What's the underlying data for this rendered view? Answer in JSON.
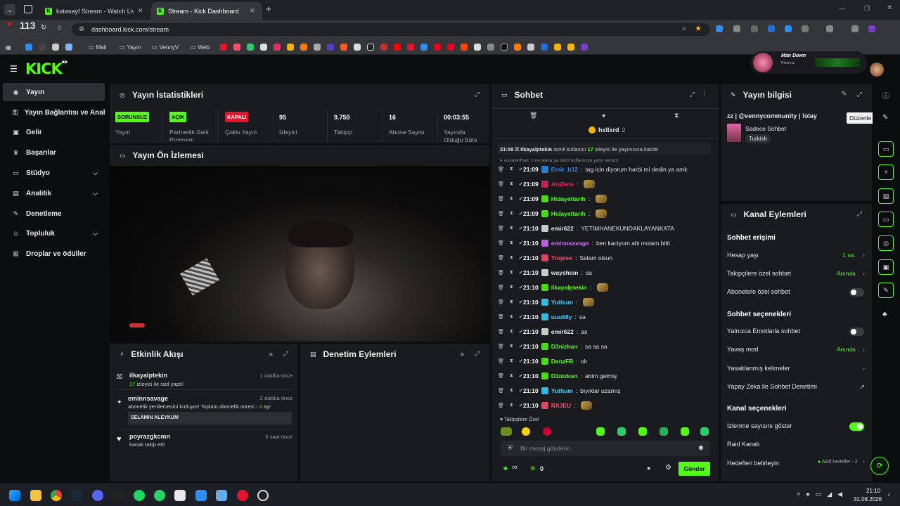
{
  "browser": {
    "tabs": [
      {
        "label": "katasayf Stream - Watch Live o"
      },
      {
        "label": "Stream - Kick Dashboard"
      }
    ],
    "notification_count": "113",
    "url": "dashboard.kick.com/stream",
    "bookmarks": [
      "Mail",
      "Yayın",
      "VennyV",
      "Web"
    ]
  },
  "header": {
    "logo": "KICK",
    "logo_sup": "BETA",
    "now_playing_title": "Man Down",
    "now_playing_artist": "Rihanna"
  },
  "sidebar": {
    "items": [
      {
        "label": "Yayın",
        "icon": "broadcast-icon"
      },
      {
        "label": "Yayın Bağlantısı ve Anahtarı",
        "icon": "key-icon"
      },
      {
        "label": "Gelir",
        "icon": "revenue-icon"
      },
      {
        "label": "Başarılar",
        "icon": "trophy-icon"
      },
      {
        "label": "Stüdyo",
        "icon": "studio-icon"
      },
      {
        "label": "Analitik",
        "icon": "analytics-icon"
      },
      {
        "label": "Denetleme",
        "icon": "wrench-icon"
      },
      {
        "label": "Topluluk",
        "icon": "community-icon"
      },
      {
        "label": "Droplar ve ödüller",
        "icon": "gift-icon"
      }
    ]
  },
  "stats": {
    "title": "Yayın İstatistikleri",
    "items": [
      {
        "value": "SORUNSUZ",
        "label": "Yayın",
        "badge_color": "#53fc18"
      },
      {
        "value": "AÇIK",
        "label": "Partnerlik Gelir Programı",
        "badge_color": "#53fc18"
      },
      {
        "value": "KAPALI",
        "label": "Çoklu Yayın",
        "badge_color": "#e5132b"
      },
      {
        "value": "95",
        "label": "İzleyici"
      },
      {
        "value": "9.750",
        "label": "Takipçi"
      },
      {
        "value": "16",
        "label": "Abone Sayısı"
      },
      {
        "value": "00:03:55",
        "label": "Yayında Olduğu Süre"
      }
    ]
  },
  "preview": {
    "title": "Yayın Ön İzlemesi"
  },
  "activity": {
    "title": "Etkinlik Akışı",
    "items": [
      {
        "user": "ilkayalptekin",
        "time": "1 dakika önce",
        "count": "17",
        "text": "izleyici ile raid yaptı!"
      },
      {
        "user": "eminnsavage",
        "time": "2 dakika önce",
        "text": "abonelik yenilemesini kutluyor! Toplam abonelik süresi -",
        "count": "2",
        "unit": "ay!",
        "quote": "SELAMIN ALEYKUM"
      },
      {
        "user": "poyrazgkcmn",
        "time": "5 saat önce",
        "text": "kanalı takip etti"
      }
    ]
  },
  "moderation": {
    "title": "Denetim Eylemleri"
  },
  "chat": {
    "title": "Sohbet",
    "pinned_user": "hxllxrd",
    "pinned_count": "2",
    "raid_notice": {
      "time": "21:09",
      "user": "ilkayalptekin",
      "text_a": "isimli kullanıcı",
      "count": "17",
      "text_b": "izleyici ile yayınınıza katıldı"
    },
    "reply_notice": "AssasinHan: o ne alaka ya isimli kullanıcıya yanıt veriyor",
    "messages": [
      {
        "time": "21:09",
        "user": "Emir_b12",
        "color": "#2f8cf0",
        "text": "tag icin diyorum harbi mi dedin ya amk"
      },
      {
        "time": "21:09",
        "user": "AtaDete",
        "color": "#e0245e",
        "text": ""
      },
      {
        "time": "21:09",
        "user": "Hidayettarih",
        "color": "#53fc18",
        "text": ""
      },
      {
        "time": "21:09",
        "user": "Hidayettarih",
        "color": "#53fc18",
        "text": ""
      },
      {
        "time": "21:10",
        "user": "emir622",
        "color": "#e8e8e8",
        "text": "YETİMHANEKUNDAKLAYANKATA"
      },
      {
        "time": "21:10",
        "user": "eminnsavage",
        "color": "#d36bff",
        "text": "ben kaciyom abi molam bitti"
      },
      {
        "time": "21:10",
        "user": "Troplex",
        "color": "#ff4d6d",
        "text": "Selam olsun"
      },
      {
        "time": "21:10",
        "user": "wayshion",
        "color": "#e8e8e8",
        "text": "sa"
      },
      {
        "time": "21:10",
        "user": "ilkayalptekin",
        "color": "#53fc18",
        "text": ""
      },
      {
        "time": "21:10",
        "user": "Yuthum",
        "color": "#3fd2ff",
        "text": ""
      },
      {
        "time": "21:10",
        "user": "uuu68y",
        "color": "#3fd2ff",
        "text": "sa"
      },
      {
        "time": "21:10",
        "user": "emir622",
        "color": "#e8e8e8",
        "text": "as"
      },
      {
        "time": "21:10",
        "user": "D3nizkun",
        "color": "#53fc18",
        "text": "sa sa sa"
      },
      {
        "time": "21:10",
        "user": "DenzFR",
        "color": "#53fc18",
        "text": "olr"
      },
      {
        "time": "21:10",
        "user": "D3nizkun",
        "color": "#53fc18",
        "text": "abim gelmiş"
      },
      {
        "time": "21:10",
        "user": "Yuthum",
        "color": "#3fd2ff",
        "text": "bıyıklar uzamış"
      },
      {
        "time": "21:10",
        "user": "RXJEU",
        "color": "#ff4d6d",
        "text": ""
      }
    ],
    "followers_only": "Takipçilere Özel",
    "input_placeholder": "Bir mesaj gönderin",
    "points_value": "0",
    "infinity": "∞",
    "send_label": "Gönder"
  },
  "stream_info": {
    "title": "Yayın bilgisi",
    "stream_title": "zz | @vennycommunity | !olay",
    "category": "Sadece Sohbet",
    "language": "Turkish",
    "tooltip": "Düzenle"
  },
  "channel_actions": {
    "title": "Kanal Eylemleri",
    "section_access": "Sohbet erişimi",
    "account_age_label": "Hesap yaşı",
    "account_age_value": "1 sa.",
    "followers_chat_label": "Takipçilere özel sohbet",
    "followers_chat_value": "Anında",
    "subscribers_chat_label": "Abonelere özel sohbet",
    "section_options": "Sohbet seçenekleri",
    "emote_only_label": "Yalnızca Emotlarla sohbet",
    "slow_mode_label": "Yavaş mod",
    "slow_mode_value": "Anında",
    "banned_words_label": "Yasaklanmış kelimeler",
    "ai_moderation_label": "Yapay Zeka ile Sohbet Denetimi",
    "section_channel": "Kanal seçenekleri",
    "show_viewers_label": "İzlenme sayısını göster",
    "raid_label": "Raid Kanalı",
    "goals_label": "Hedefleri belirleyin",
    "goals_value": "Aktif hedefler - 2"
  },
  "taskbar": {
    "time": "21:10",
    "date": "31.08.2026"
  },
  "colors": {
    "accent": "#53fc18",
    "panel": "#191b1f",
    "bg": "#0b0e0f"
  }
}
